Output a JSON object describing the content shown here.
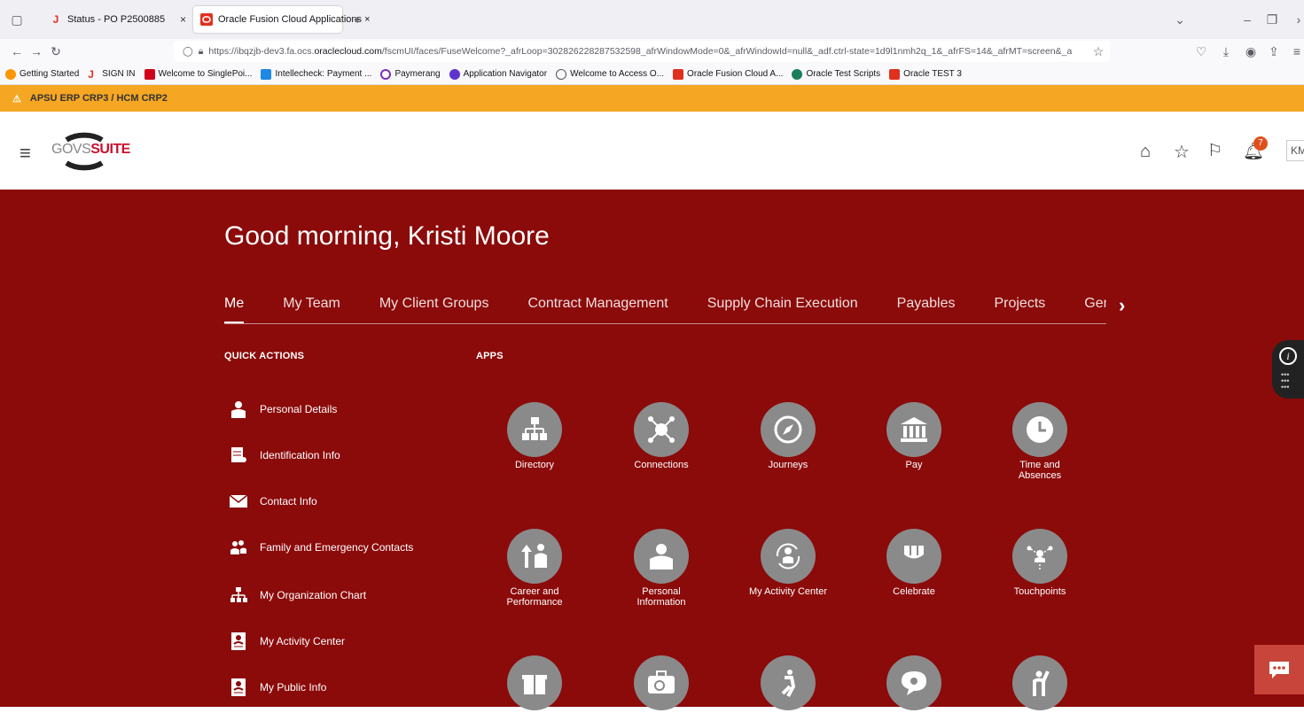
{
  "browser": {
    "tabs": [
      {
        "label": "Status - PO P2500885"
      },
      {
        "label": "Oracle Fusion Cloud Applications ×"
      }
    ],
    "url_prefix": "https://ibqzjb-dev3.fa.ocs.",
    "url_domain": "oraclecloud.com",
    "url_suffix": "/fscmUI/faces/FuseWelcome?_afrLoop=302826228287532598_afrWindowMode=0&_afrWindowId=null&_adf.ctrl-state=1d9l1nmh2q_1&_afrFS=14&_afrMT=screen&_a",
    "bookmarks": [
      {
        "label": "Getting Started",
        "color": "#ff9500"
      },
      {
        "label": "SIGN IN",
        "color": "#e0301e"
      },
      {
        "label": "Welcome to SinglePoi...",
        "color": "#d0021b"
      },
      {
        "label": "Intellecheck: Payment ...",
        "color": "#1e88e5"
      },
      {
        "label": "Paymerang",
        "color": "#7b2fbe"
      },
      {
        "label": "Application Navigator",
        "color": "#5c35cc"
      },
      {
        "label": "Welcome to Access O...",
        "color": "#555555"
      },
      {
        "label": "Oracle Fusion Cloud A...",
        "color": "#e0301e"
      },
      {
        "label": "Oracle Test Scripts",
        "color": "#1a7f5a"
      },
      {
        "label": "Oracle TEST 3",
        "color": "#e0301e"
      }
    ]
  },
  "env_banner": "APSU ERP CRP3 / HCM CRP2",
  "header": {
    "logo_text_a": "GOVS",
    "logo_text_b": "SUITE",
    "notification_count": "7",
    "user_initials": "KM"
  },
  "hero": {
    "greeting": "Good morning, Kristi Moore",
    "tabs": [
      "Me",
      "My Team",
      "My Client Groups",
      "Contract Management",
      "Supply Chain Execution",
      "Payables",
      "Projects",
      "General Ac"
    ],
    "quick_actions_label": "QUICK ACTIONS",
    "apps_label": "APPS",
    "quick_actions": [
      {
        "label": "Personal Details",
        "icon": "person-icon"
      },
      {
        "label": "Identification Info",
        "icon": "id-doc-icon"
      },
      {
        "label": "Contact Info",
        "icon": "envelope-icon"
      },
      {
        "label": "Family and Emergency Contacts",
        "icon": "family-icon"
      },
      {
        "label": "My Organization Chart",
        "icon": "org-chart-icon"
      },
      {
        "label": "My Activity Center",
        "icon": "badge-icon"
      },
      {
        "label": "My Public Info",
        "icon": "badge-icon"
      }
    ],
    "apps_row1": [
      "Directory",
      "Connections",
      "Journeys",
      "Pay",
      "Time and Absences"
    ],
    "apps_row2": [
      "Career and Performance",
      "Personal Information",
      "My Activity Center",
      "Celebrate",
      "Touchpoints"
    ]
  },
  "colors": {
    "hero_bg": "#8b0a0a",
    "env_banner": "#f5a623",
    "app_circle": "#8a8a8a",
    "chat_button": "#c7453a"
  }
}
